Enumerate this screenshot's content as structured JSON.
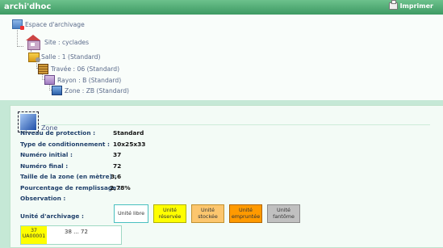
{
  "app": {
    "title": "archi'dhoc",
    "print_label": "Imprimer"
  },
  "tree": {
    "root": "Espace d'archivage",
    "site": "Site : cyclades",
    "salle": "Salle : 1 (Standard)",
    "travee": "Travée : 06 (Standard)",
    "rayon": "Rayon : B (Standard)",
    "zone": "Zone : ZB (Standard)"
  },
  "zone_panel": {
    "title": "Zone",
    "fields": [
      {
        "label": "Niveau de protection :",
        "value": "Standard"
      },
      {
        "label": "Type de conditionnement :",
        "value": "10x25x33"
      },
      {
        "label": "Numéro initial :",
        "value": "37"
      },
      {
        "label": "Numéro final :",
        "value": "72"
      },
      {
        "label": "Taille de la zone (en mètre) :",
        "value": "3,6"
      },
      {
        "label": "Pourcentage de remplissage :",
        "value": "2,78%"
      },
      {
        "label": "Observation :",
        "value": ""
      }
    ],
    "unit_label": "Unité d'archivage :",
    "legend": [
      {
        "label": "Unité libre",
        "color": "#ffffff"
      },
      {
        "label": "Unité réservée",
        "color": "#fefe00"
      },
      {
        "label": "Unité stockée",
        "color": "#fcc66e"
      },
      {
        "label": "Unité empruntée",
        "color": "#ff9a00"
      },
      {
        "label": "Unité fantôme",
        "color": "#c0c0c0"
      }
    ],
    "units": {
      "first_number": "37",
      "first_code": "UA00001",
      "range": "38 ... 72"
    }
  }
}
